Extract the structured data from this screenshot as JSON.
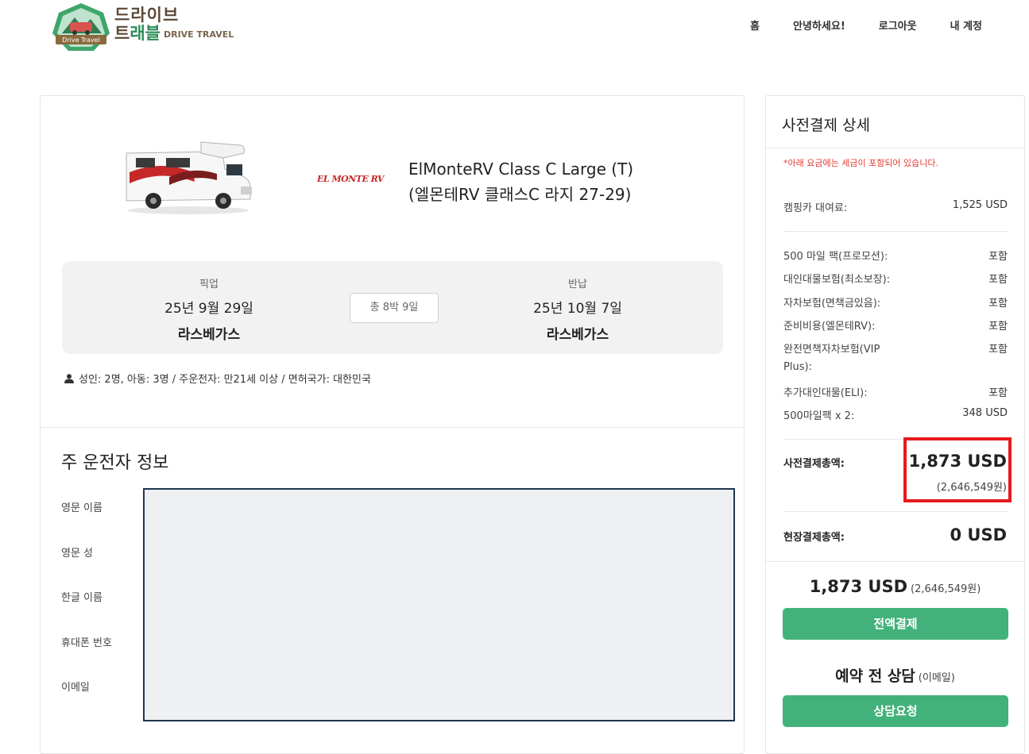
{
  "header": {
    "logo": {
      "badge_text": "Drive Travel",
      "line1": "드라이브",
      "line2_a": "트",
      "line2_b": "래블",
      "line2_en": "DRIVE TRAVEL"
    },
    "nav": [
      "홈",
      "안녕하세요!",
      "로그아웃",
      "내 계정"
    ]
  },
  "vehicle": {
    "brand_logo": "EL MONTE RV",
    "title_line1": "ElMonteRV Class C Large (T)",
    "title_line2": "(엘몬테RV 클래스C 라지 27-29)"
  },
  "trip": {
    "pickup_label": "픽업",
    "pickup_date": "25년 9월 29일",
    "pickup_place": "라스베가스",
    "duration": "총 8박 9일",
    "return_label": "반납",
    "return_date": "25년 10월 7일",
    "return_place": "라스베가스",
    "passengers": "성인: 2명, 아동: 3명 / 주운전자: 만21세 이상 / 면허국가: 대한민국"
  },
  "driver_form": {
    "title": "주 운전자 정보",
    "fields": [
      "영문 이름",
      "영문 성",
      "한글 이름",
      "휴대폰 번호",
      "이메일"
    ]
  },
  "payment": {
    "title": "사전결제 상세",
    "tax_note": "*아래 요금에는 세금이 포함되어 있습니다.",
    "rental_label": "캠핑카 대여료:",
    "rental_value": "1,525 USD",
    "items": [
      {
        "label": "500 마일 팩(프로모션):",
        "value": "포함"
      },
      {
        "label": "대인대물보험(최소보장):",
        "value": "포함"
      },
      {
        "label": "자차보험(면책금있음):",
        "value": "포함"
      },
      {
        "label": "준비비용(엘몬테RV):",
        "value": "포함"
      },
      {
        "label": "완전면책자차보험(VIP",
        "label2": "Plus):",
        "value": "포함"
      },
      {
        "label": "추가대인대물(ELI):",
        "value": "포함"
      },
      {
        "label": "500마일팩 x 2:",
        "value": "348 USD"
      }
    ],
    "prepay_label": "사전결제총액:",
    "prepay_total": "1,873 USD",
    "prepay_krw": "(2,646,549원)",
    "onsite_label": "현장결제총액:",
    "onsite_total": "0 USD",
    "summary_total": "1,873 USD",
    "summary_krw": "(2,646,549원)",
    "pay_button": "전액결제",
    "consult_title": "예약 전 상담",
    "consult_sub": "(이메일)",
    "consult_button": "상담요청"
  },
  "colors": {
    "accent_green": "#43b27a",
    "highlight_red": "#e8191c",
    "note_red": "#e53935"
  }
}
